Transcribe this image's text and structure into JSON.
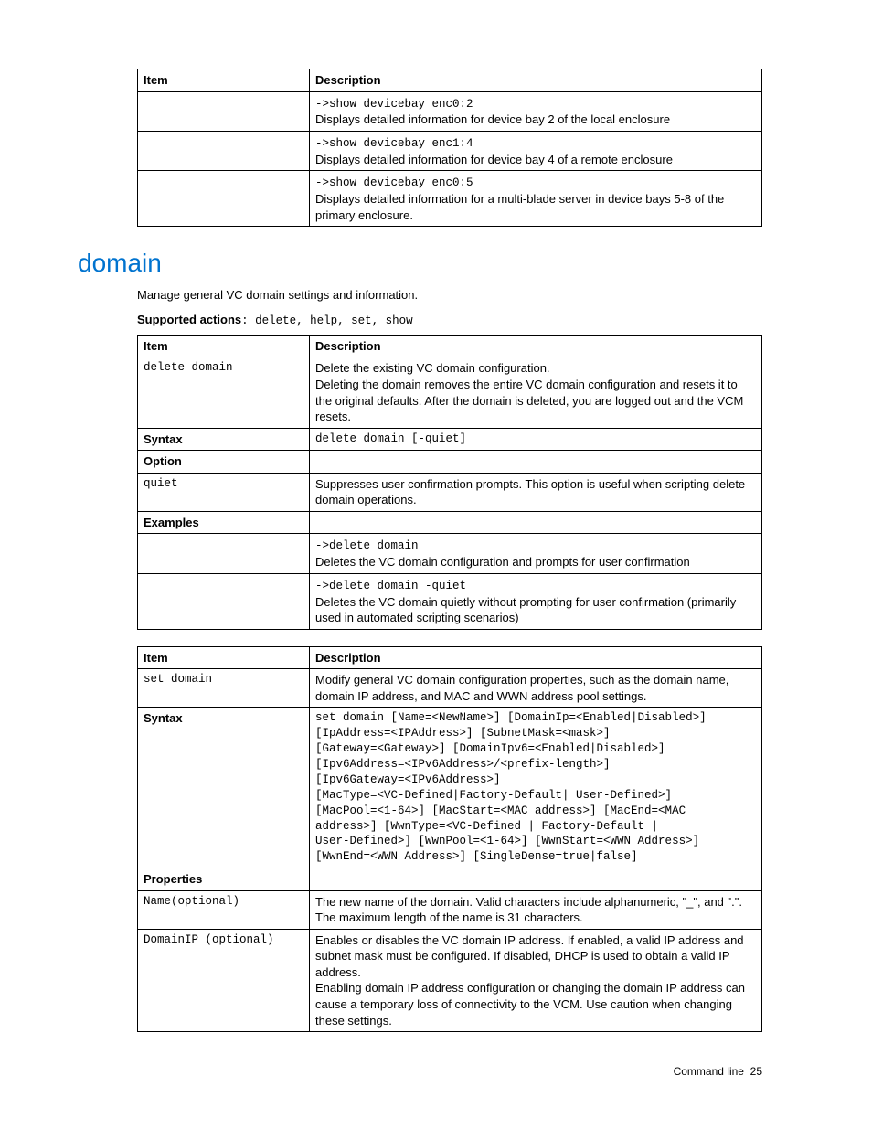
{
  "table1": {
    "h1": "Item",
    "h2": "Description",
    "rows": [
      {
        "item": "",
        "cmd": "->show devicebay enc0:2",
        "desc": "Displays detailed information for device bay 2 of the local enclosure"
      },
      {
        "item": "",
        "cmd": "->show devicebay enc1:4",
        "desc": "Displays detailed information for device bay 4 of a remote enclosure"
      },
      {
        "item": "",
        "cmd": "->show devicebay enc0:5",
        "desc": "Displays detailed information for a multi-blade server in device bays 5-8 of the primary enclosure."
      }
    ]
  },
  "section": {
    "heading": "domain",
    "intro": "Manage general VC domain settings and information.",
    "supported_label": "Supported actions",
    "supported_actions": ": delete, help, set, show"
  },
  "table2": {
    "h1": "Item",
    "h2": "Description",
    "rows": {
      "r0": {
        "item": "delete domain",
        "desc_a": "Delete the existing VC domain configuration.",
        "desc_b": "Deleting the domain removes the entire VC domain configuration and resets it to the original defaults. After the domain is deleted, you are logged out and the VCM resets."
      },
      "r1": {
        "item": "Syntax",
        "cmd": "delete domain [-quiet]"
      },
      "r2": {
        "item": "Option"
      },
      "r3": {
        "item": "quiet",
        "desc": "Suppresses user confirmation prompts. This option is useful when scripting delete domain operations."
      },
      "r4": {
        "item": "Examples"
      },
      "r5": {
        "cmd": "->delete domain",
        "desc": "Deletes the VC domain configuration and prompts for user confirmation"
      },
      "r6": {
        "cmd": "->delete domain -quiet",
        "desc": "Deletes the VC domain quietly without prompting for user confirmation (primarily used in automated scripting scenarios)"
      }
    }
  },
  "table3": {
    "h1": "Item",
    "h2": "Description",
    "rows": {
      "r0": {
        "item": "set domain",
        "desc": "Modify general VC domain configuration properties, such as the domain name, domain IP address, and MAC and WWN address pool settings."
      },
      "r1": {
        "item": "Syntax",
        "l0": "set domain [Name=<NewName>] [DomainIp=<Enabled|Disabled>]",
        "l1": "[IpAddress=<IPAddress>] [SubnetMask=<mask>]",
        "l2": "[Gateway=<Gateway>] [DomainIpv6=<Enabled|Disabled>]",
        "l3": "[Ipv6Address=<IPv6Address>/<prefix-length>]",
        "l4": "[Ipv6Gateway=<IPv6Address>]",
        "l5": "[MacType=<VC-Defined|Factory-Default| User-Defined>]",
        "l6": "[MacPool=<1-64>] [MacStart=<MAC address>] [MacEnd=<MAC",
        "l7": "address>] [WwnType=<VC-Defined | Factory-Default |",
        "l8": "User-Defined>] [WwnPool=<1-64>] [WwnStart=<WWN Address>]",
        "l9": "[WwnEnd=<WWN Address>] [SingleDense=true|false]"
      },
      "r2": {
        "item": "Properties"
      },
      "r3": {
        "item": "Name(optional)",
        "desc": "The new name of the domain. Valid characters include alphanumeric, \"_\", and \".\". The maximum length of the name is 31 characters."
      },
      "r4": {
        "item": "DomainIP (optional)",
        "desc_a": "Enables or disables the VC domain IP address. If enabled, a valid IP address and subnet mask must be configured. If disabled, DHCP is used to obtain a valid IP address.",
        "desc_b": "Enabling domain IP address configuration or changing the domain IP address can cause a temporary loss of connectivity to the VCM. Use caution when changing these settings."
      }
    }
  },
  "footer": {
    "label": "Command line",
    "page": "25"
  }
}
